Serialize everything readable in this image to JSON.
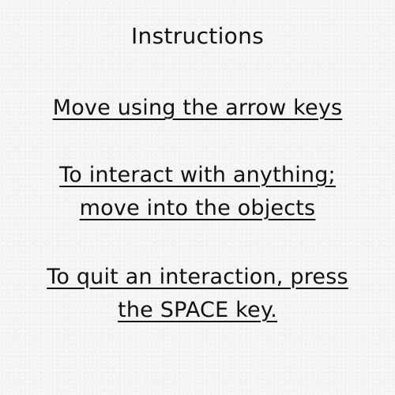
{
  "instructions": {
    "title": "Instructions",
    "block_1": {
      "line_1": "Move using the arrow keys"
    },
    "block_2": {
      "line_1": "To interact with anything;",
      "line_2": "move into the objects"
    },
    "block_3": {
      "line_1": "To quit an interaction, press",
      "line_2": "the SPACE key."
    }
  }
}
